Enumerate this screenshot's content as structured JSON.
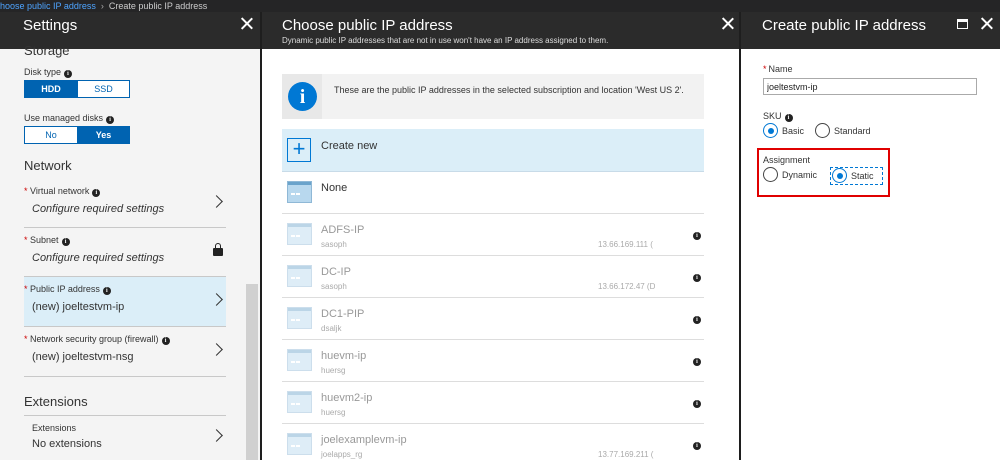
{
  "breadcrumb": {
    "link": "hoose public IP address",
    "current": "Create public IP address"
  },
  "settings": {
    "title": "Settings",
    "storage_heading": "Storage",
    "disk_type_label": "Disk type",
    "disk_type_options": [
      "HDD",
      "SSD"
    ],
    "managed_disks_label": "Use managed disks",
    "managed_disks_options": [
      "No",
      "Yes"
    ],
    "network_heading": "Network",
    "items": [
      {
        "label": "Virtual network",
        "value": "Configure required settings"
      },
      {
        "label": "Subnet",
        "value": "Configure required settings"
      },
      {
        "label": "Public IP address",
        "value": "(new) joeltestvm-ip"
      },
      {
        "label": "Network security group (firewall)",
        "value": "(new) joeltestvm-nsg"
      }
    ],
    "extensions_heading": "Extensions",
    "extensions_item": {
      "label": "Extensions",
      "value": "No extensions"
    }
  },
  "choose": {
    "title": "Choose public IP address",
    "subtitle": "Dynamic public IP addresses that are not in use won't have an IP address assigned to them.",
    "info_text": "These are the public IP addresses in the selected subscription and location 'West US 2'.",
    "create_new": "Create new",
    "none": "None",
    "addresses": [
      {
        "name": "ADFS-IP",
        "rg": "sasoph",
        "ip": "13.66.169.111 ("
      },
      {
        "name": "DC-IP",
        "rg": "sasoph",
        "ip": "13.66.172.47 (D"
      },
      {
        "name": "DC1-PIP",
        "rg": "dsaljk",
        "ip": ""
      },
      {
        "name": "huevm-ip",
        "rg": "huersg",
        "ip": ""
      },
      {
        "name": "huevm2-ip",
        "rg": "huersg",
        "ip": ""
      },
      {
        "name": "joelexamplevm-ip",
        "rg": "joelapps_rg",
        "ip": "13.77.169.211 ("
      }
    ]
  },
  "create": {
    "title": "Create public IP address",
    "name_label": "Name",
    "name_value": "joeltestvm-ip",
    "sku_label": "SKU",
    "sku_options": [
      "Basic",
      "Standard"
    ],
    "assignment_label": "Assignment",
    "assignment_options": [
      "Dynamic",
      "Static"
    ]
  },
  "colors": {
    "accent": "#0078d4",
    "highlight": "#e00000",
    "header": "#2b2b2b"
  }
}
